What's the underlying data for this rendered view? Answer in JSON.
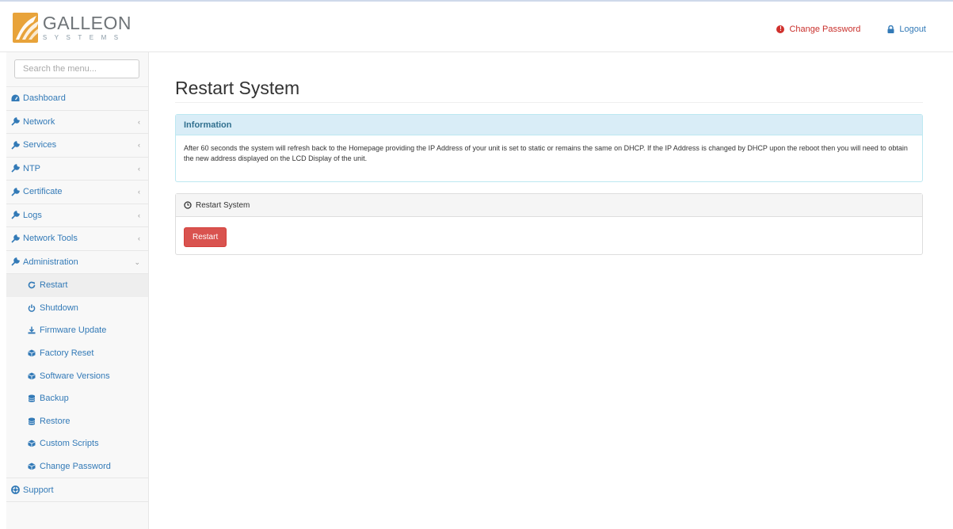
{
  "header": {
    "logo_name": "GALLEON",
    "logo_sub": "SYSTEMS",
    "change_password": "Change Password",
    "logout": "Logout",
    "accent_color": "#e8a33a"
  },
  "sidebar": {
    "search_placeholder": "Search the menu...",
    "items": [
      {
        "label": "Dashboard",
        "icon": "dashboard-icon"
      },
      {
        "label": "Network",
        "icon": "wrench-icon"
      },
      {
        "label": "Services",
        "icon": "wrench-icon"
      },
      {
        "label": "NTP",
        "icon": "wrench-icon"
      },
      {
        "label": "Certificate",
        "icon": "wrench-icon"
      },
      {
        "label": "Logs",
        "icon": "wrench-icon"
      },
      {
        "label": "Network Tools",
        "icon": "wrench-icon"
      },
      {
        "label": "Administration",
        "icon": "wrench-icon"
      }
    ],
    "admin_sub": [
      {
        "label": "Restart",
        "icon": "refresh-icon"
      },
      {
        "label": "Shutdown",
        "icon": "power-icon"
      },
      {
        "label": "Firmware Update",
        "icon": "download-icon"
      },
      {
        "label": "Factory Reset",
        "icon": "cube-icon"
      },
      {
        "label": "Software Versions",
        "icon": "cube-icon"
      },
      {
        "label": "Backup",
        "icon": "database-icon"
      },
      {
        "label": "Restore",
        "icon": "database-icon"
      },
      {
        "label": "Custom Scripts",
        "icon": "cube-icon"
      },
      {
        "label": "Change Password",
        "icon": "cube-icon"
      }
    ],
    "support": "Support"
  },
  "main": {
    "title": "Restart System",
    "info_heading": "Information",
    "info_text": "After 60 seconds the system will refresh back to the Homepage providing the IP Address of your unit is set to static or remains the same on DHCP. If the IP Address is changed by DHCP upon the reboot then you will need to obtain the new address displayed on the LCD Display of the unit.",
    "restart_panel_heading": "Restart System",
    "restart_button": "Restart"
  }
}
